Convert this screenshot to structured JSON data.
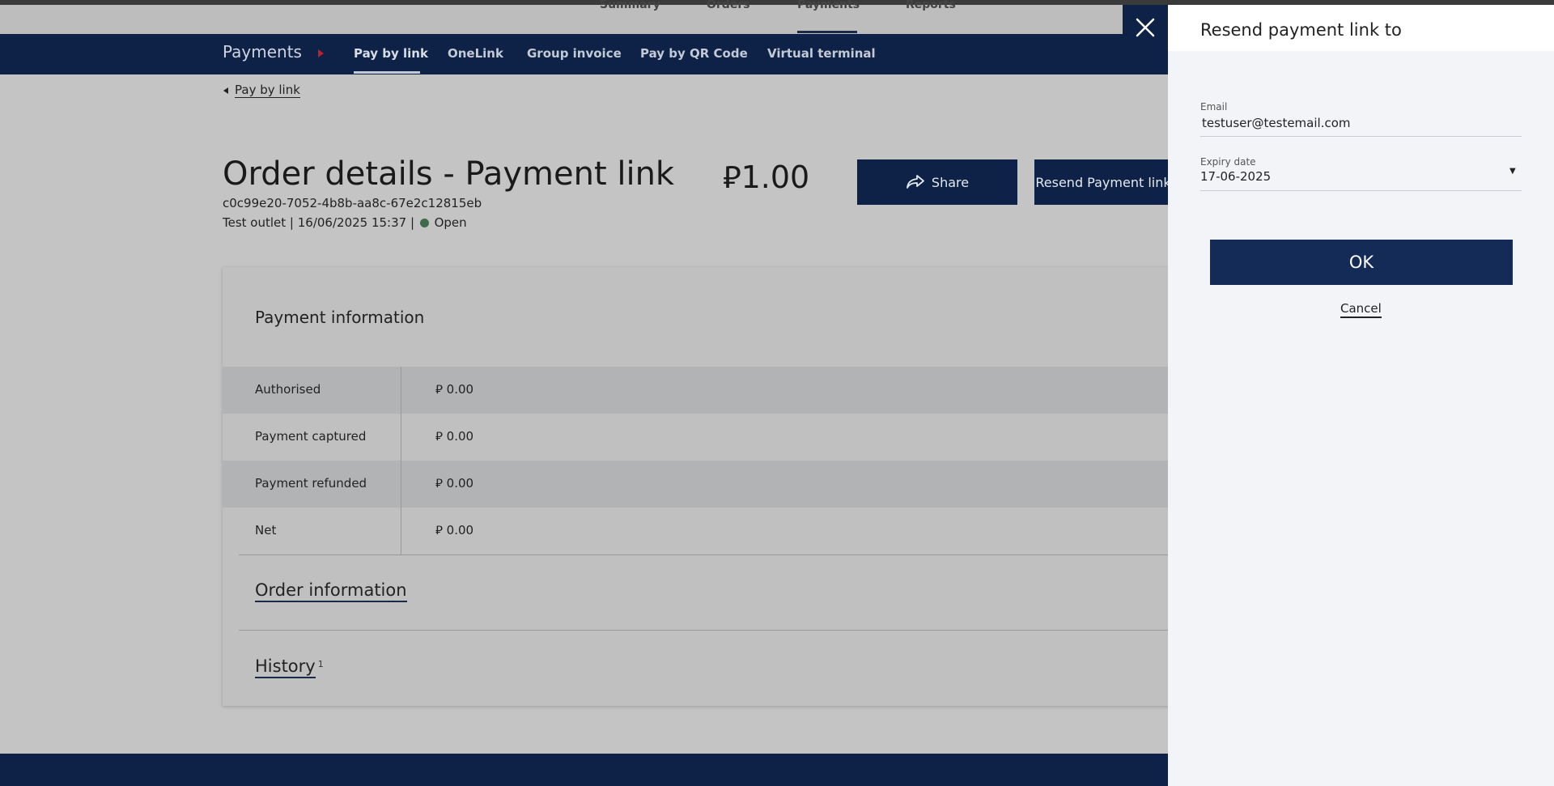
{
  "top_nav": {
    "items": [
      "Summary",
      "Orders",
      "Payments",
      "Reports"
    ]
  },
  "sub_nav": {
    "section_title": "Payments",
    "tabs": [
      "Pay by link",
      "OneLink",
      "Group invoice",
      "Pay by QR Code",
      "Virtual terminal"
    ],
    "active_tab": "Pay by link"
  },
  "back_link": "Pay by link",
  "order": {
    "title": "Order details - Payment link",
    "amount": "⃁1.00",
    "id": "c0c99e20-7052-4b8b-aa8c-67e2c12815eb",
    "outlet": "Test outlet",
    "datetime": "16/06/2025 15:37",
    "status": "Open",
    "status_color": "#3e6b4a"
  },
  "buttons": {
    "share": "Share",
    "resend": "Resend Payment link"
  },
  "payment_info": {
    "title": "Payment information",
    "rows": [
      {
        "label": "Authorised",
        "value": "⃁ 0.00"
      },
      {
        "label": "Payment captured",
        "value": "⃁ 0.00"
      },
      {
        "label": "Payment refunded",
        "value": "⃁ 0.00"
      },
      {
        "label": "Net",
        "value": "⃁ 0.00"
      }
    ]
  },
  "order_info_title": "Order information",
  "history": {
    "title": "History",
    "count": "1"
  },
  "panel": {
    "title": "Resend payment link to",
    "email_label": "Email",
    "email_value": "testuser@testemail.com",
    "expiry_label": "Expiry date",
    "expiry_value": "17-06-2025",
    "ok": "OK",
    "cancel": "Cancel"
  },
  "colors": {
    "navy": "#0e2146",
    "ok_button": "#142a57",
    "accent_red": "#c0202a"
  }
}
